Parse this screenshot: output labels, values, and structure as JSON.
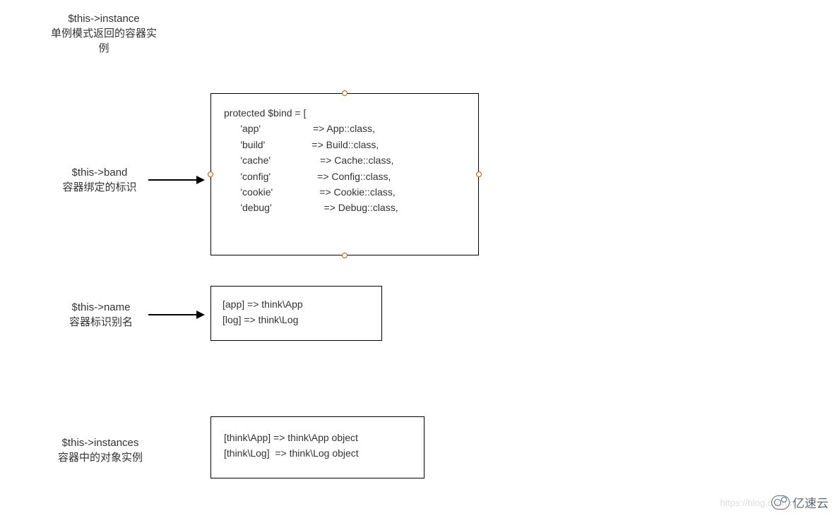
{
  "labels": {
    "instance": {
      "title": "$this->instance",
      "desc": "单例模式返回的容器实\n例"
    },
    "band": {
      "title": "$this->band",
      "desc": "容器绑定的标识"
    },
    "name": {
      "title": "$this->name",
      "desc": "容器标识别名"
    },
    "instances": {
      "title": "$this->instances",
      "desc": "容器中的对象实例"
    }
  },
  "boxes": {
    "bind": "protected $bind = [\n      'app'                   => App::class,\n      'build'                 => Build::class,\n      'cache'                  => Cache::class,\n      'config'                 => Config::class,\n      'cookie'                 => Cookie::class,\n      'debug'                   => Debug::class,",
    "name": "[app] => think\\App\n[log] => think\\Log",
    "instances": "[think\\App] => think\\App object\n[think\\Log]  => think\\Log object"
  },
  "watermark": "https://blog.csdn.n",
  "logo_text": "亿速云"
}
